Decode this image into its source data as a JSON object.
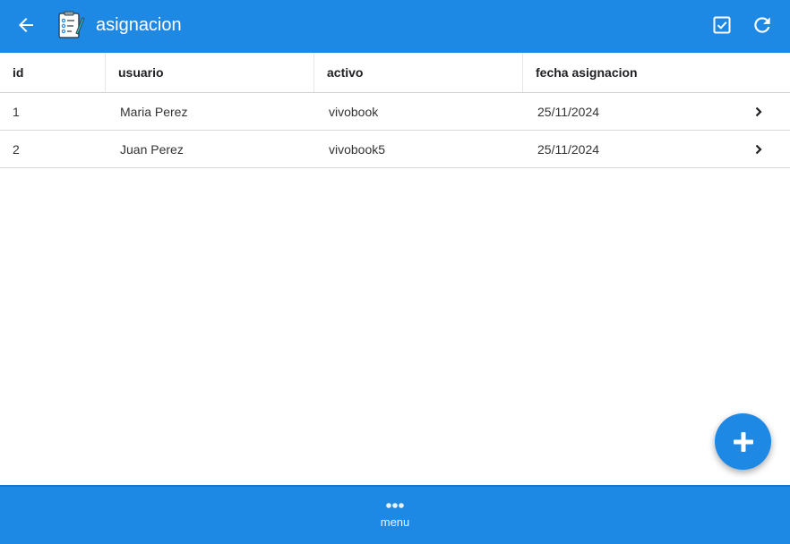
{
  "header": {
    "title": "asignacion",
    "back_icon": "arrow-left-icon",
    "logo_icon": "clipboard-checklist-icon",
    "actions": [
      {
        "name": "checkbox-icon"
      },
      {
        "name": "refresh-icon"
      }
    ],
    "bg_color": "#1e88e5"
  },
  "table": {
    "columns": [
      "id",
      "usuario",
      "activo",
      "fecha asignacion"
    ],
    "rows": [
      {
        "id": "1",
        "usuario": "Maria Perez",
        "activo": "vivobook",
        "fecha": "25/11/2024"
      },
      {
        "id": "2",
        "usuario": "Juan Perez",
        "activo": "vivobook5",
        "fecha": "25/11/2024"
      }
    ]
  },
  "fab": {
    "icon": "plus-icon"
  },
  "bottom_nav": {
    "menu_label": "menu",
    "menu_icon": "more-dots-icon"
  }
}
